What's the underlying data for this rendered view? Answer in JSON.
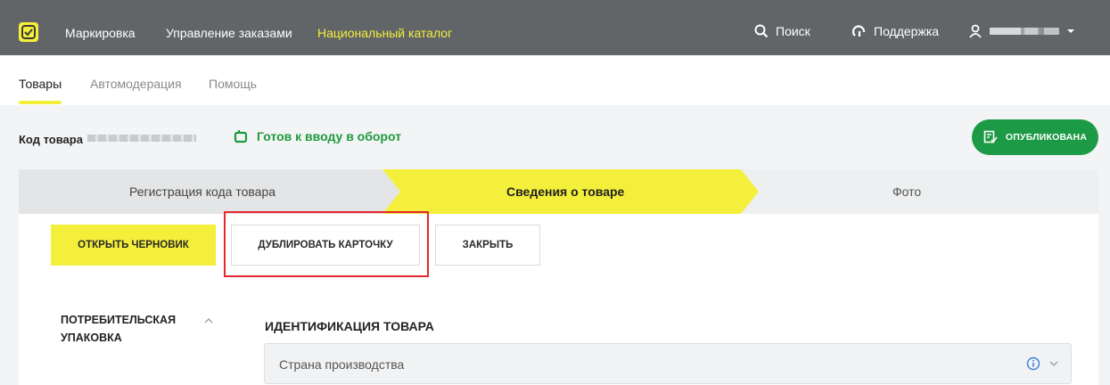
{
  "topbar": {
    "nav": [
      "Маркировка",
      "Управление заказами",
      "Национальный каталог"
    ],
    "active_nav": "Национальный каталог",
    "search_label": "Поиск",
    "support_label": "Поддержка",
    "icons": [
      "logo-icon",
      "search-icon",
      "support-icon",
      "user-icon",
      "caret-down-icon"
    ]
  },
  "subnav": {
    "tabs": [
      "Товары",
      "Автомодерация",
      "Помощь"
    ],
    "active_tab": "Товары"
  },
  "product": {
    "code_label": "Код товара",
    "status_label": "Готов к вводу в оборот",
    "publish_label": "ОПУБЛИКОВАНА"
  },
  "steps": [
    {
      "label": "Регистрация кода товара",
      "state": "done"
    },
    {
      "label": "Сведения о товаре",
      "state": "active"
    },
    {
      "label": "Фото",
      "state": "pending"
    }
  ],
  "actions": {
    "open_draft": "ОТКРЫТЬ ЧЕРНОВИК",
    "duplicate": "ДУБЛИРОВАТЬ КАРТОЧКУ",
    "close": "ЗАКРЫТЬ"
  },
  "sidebar": {
    "section": "ПОТРЕБИТЕЛЬСКАЯ УПАКОВКА"
  },
  "form": {
    "section_title": "ИДЕНТИФИКАЦИЯ ТОВАРА",
    "country_placeholder": "Страна производства"
  },
  "colors": {
    "topbar": "#616568",
    "accent_yellow": "#f4ef3a",
    "success_green": "#1d9a45",
    "highlight_red": "#e4262f",
    "info_blue": "#3b7fd9"
  }
}
